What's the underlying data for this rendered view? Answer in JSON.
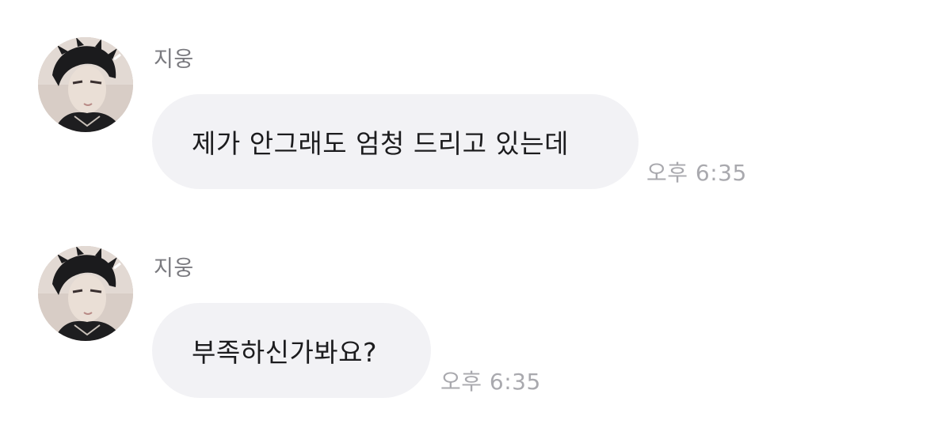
{
  "messages": [
    {
      "sender": "지웅",
      "text": "제가 안그래도 엄청 드리고 있는데",
      "time": "오후 6:35"
    },
    {
      "sender": "지웅",
      "text": "부족하신가봐요?",
      "time": "오후 6:35"
    }
  ],
  "colors": {
    "bubble": "#f2f2f5",
    "sender": "#7a7a7f",
    "time": "#a9a9ae",
    "text": "#1c1c1e"
  },
  "icons": {
    "avatar": "profile-photo"
  }
}
